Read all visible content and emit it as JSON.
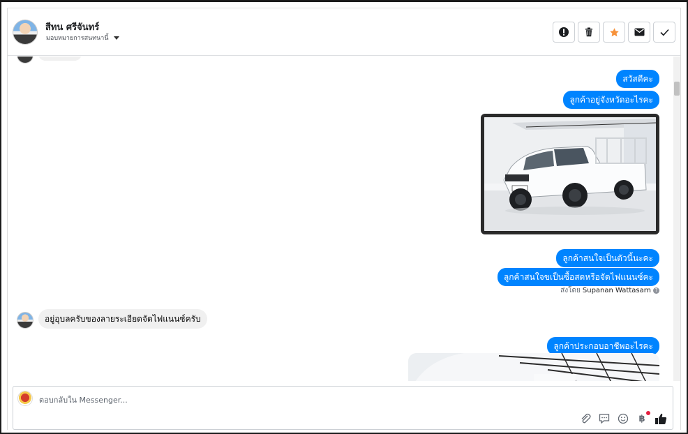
{
  "header": {
    "contact_name": "สีทน ศรีจันทร์",
    "assign_label": "มอบหมายการสนทนานี้",
    "actions": [
      {
        "name": "mark-spam-button",
        "icon": "exclamation-icon"
      },
      {
        "name": "delete-button",
        "icon": "trash-icon"
      },
      {
        "name": "star-button",
        "icon": "star-icon"
      },
      {
        "name": "mark-unread-button",
        "icon": "envelope-icon"
      },
      {
        "name": "mark-done-button",
        "icon": "check-icon"
      }
    ]
  },
  "messages": {
    "out_1": "สวัสดีคะ",
    "out_2": "ลูกค้าอยู่จังหวัดอะไรคะ",
    "out_3": "ลูกค้าสนใจเป็นตัวนี้นะคะ",
    "out_4": "ลูกค้าสนใจขเป็นซื้อสดหรือจัดไฟแนนซ์คะ",
    "sent_by_prefix": "ส่งโดย",
    "sent_by_name": "Supanan Wattasarn",
    "in_1": "อยู่อุบลครับของลายระเอียดจัดไฟแนนซ์ครับ",
    "out_5": "ลูกค้าประกอบอาชีพอะไรคะ"
  },
  "composer": {
    "placeholder": "ตอบกลับใน Messenger...",
    "tools": [
      "attachment-icon",
      "saved-reply-icon",
      "emoji-icon",
      "payment-icon",
      "like-icon"
    ]
  },
  "colors": {
    "accent": "#0084ff",
    "incoming_bubble": "#f0f0f0",
    "star": "#f7923a"
  }
}
